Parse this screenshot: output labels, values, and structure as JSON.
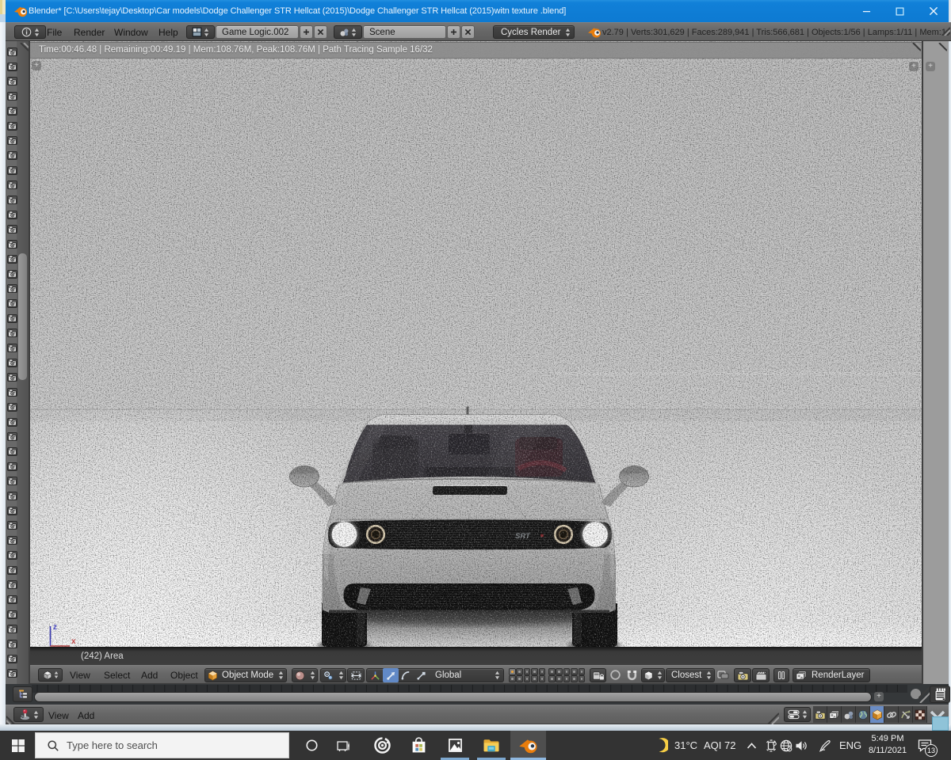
{
  "colors": {
    "accent": "#0d7ad2",
    "taskbar_underline": "#7da7ce",
    "active_tab_blue": "#6a8cc4"
  },
  "window": {
    "title": "Blender* [C:\\Users\\tejay\\Desktop\\Car models\\Dodge Challenger STR Hellcat (2015)\\Dodge Challenger STR Hellcat (2015)witn texture .blend]"
  },
  "info_header": {
    "menus": [
      "File",
      "Render",
      "Window",
      "Help"
    ],
    "layout_name": "Game Logic.002",
    "scene_name": "Scene",
    "engine": "Cycles Render",
    "stats": "v2.79 | Verts:301,629 | Faces:289,941 | Tris:566,681 | Objects:1/56 | Lamps:1/11 | Mem:1"
  },
  "render_status": "Time:00:46.48 | Remaining:00:49.19 | Mem:108.76M, Peak:108.76M | Path Tracing Sample 16/32",
  "viewport": {
    "frame_object_label": "(242) Area",
    "axis_z": "z",
    "axis_x": "x",
    "car_badge": "SRT"
  },
  "view3d_header": {
    "menus": [
      "View",
      "Select",
      "Add",
      "Object"
    ],
    "mode": "Object Mode",
    "orientation": "Global",
    "snap_element": "Closest",
    "render_layer": "RenderLayer"
  },
  "logic_header": {
    "menus": [
      "View",
      "Add"
    ]
  },
  "properties_header": {
    "tabs": [
      "render",
      "render-layers",
      "scene",
      "world",
      "object",
      "constraints",
      "physics",
      "texture"
    ]
  },
  "taskbar": {
    "search_placeholder": "Type here to search",
    "weather_temp": "31°C",
    "weather_aqi": "AQI 72",
    "language": "ENG",
    "time": "5:49 PM",
    "date": "8/11/2021",
    "notification_count": "13"
  }
}
